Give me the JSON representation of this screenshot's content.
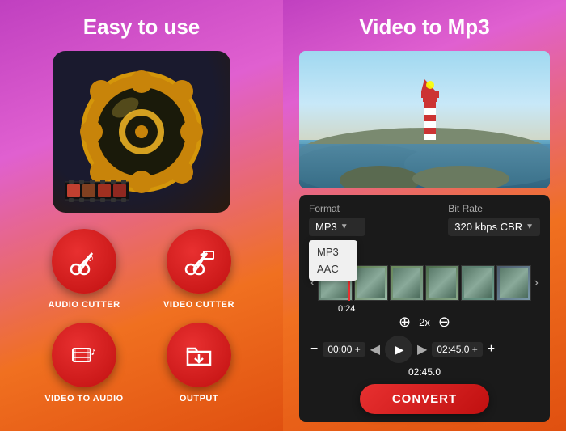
{
  "left": {
    "title": "Easy to use",
    "buttons": [
      {
        "id": "audio-cutter",
        "label": "AUDIO CUTTER",
        "icon": "scissors-music"
      },
      {
        "id": "video-cutter",
        "label": "VIDEO CUTTER",
        "icon": "scissors-video"
      },
      {
        "id": "video-to-audio",
        "label": "VIDEO TO AUDIO",
        "icon": "film-music"
      },
      {
        "id": "output",
        "label": "OUTPUT",
        "icon": "download"
      }
    ]
  },
  "right": {
    "title": "Video to Mp3",
    "format_label": "Format",
    "format_value": "MP3",
    "format_options": [
      "MP3",
      "AAC"
    ],
    "bitrate_label": "Bit Rate",
    "bitrate_value": "320 kbps CBR",
    "playhead_time": "0:24",
    "start_time": "00:00 +",
    "end_time": "02:45.0 +",
    "duration": "02:45.0",
    "zoom_level": "2x",
    "convert_label": "CONVERT"
  }
}
